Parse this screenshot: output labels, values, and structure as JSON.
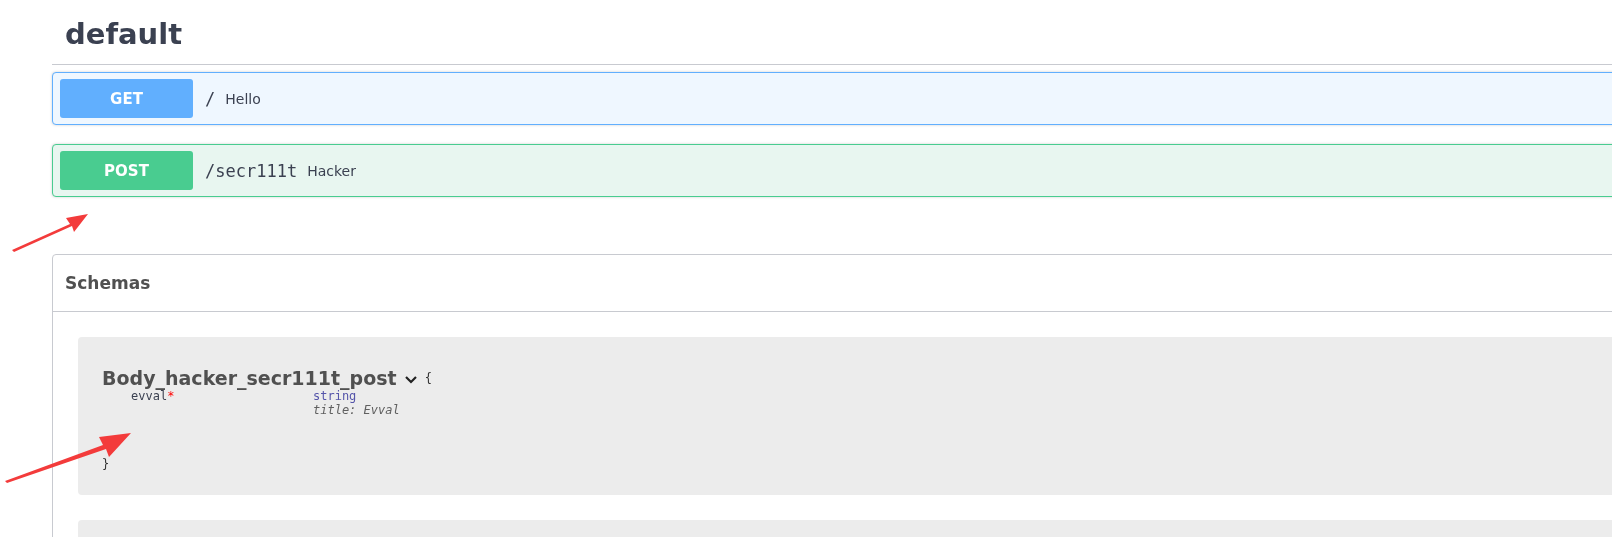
{
  "section": {
    "title": "default"
  },
  "operations": [
    {
      "kind": "get",
      "method": "GET",
      "path": "/",
      "summary": "Hello"
    },
    {
      "kind": "post",
      "method": "POST",
      "path": "/secr111t",
      "summary": "Hacker"
    }
  ],
  "schemas": {
    "title": "Schemas",
    "models": [
      {
        "name": "Body_hacker_secr111t_post",
        "expanded": true,
        "open_brace": "{",
        "close_brace": "}",
        "properties": [
          {
            "name": "evval",
            "required": true,
            "required_mark": "*",
            "type": "string",
            "title": "title: Evval"
          }
        ]
      }
    ]
  }
}
